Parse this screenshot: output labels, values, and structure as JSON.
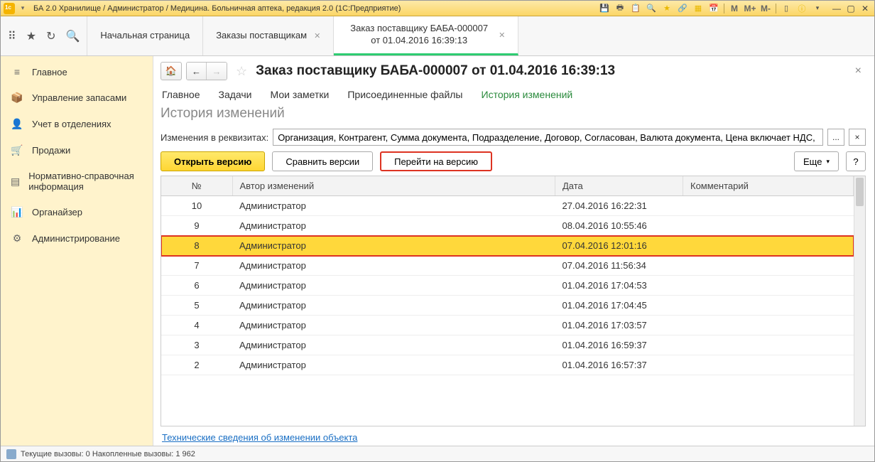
{
  "titlebar": {
    "text": "БА 2.0 Хранилище / Администратор / Медицина. Больничная аптека, редакция 2.0  (1С:Предприятие)",
    "m": "M",
    "mplus": "M+",
    "mminus": "M-"
  },
  "tabs": {
    "start": "Начальная страница",
    "orders": "Заказы поставщикам",
    "order": "Заказ поставщику БАБА-000007 от 01.04.2016 16:39:13"
  },
  "nav": {
    "main": "Главное",
    "inventory": "Управление запасами",
    "dept": "Учет в отделениях",
    "sales": "Продажи",
    "catalog": "Нормативно-справочная информация",
    "organizer": "Органайзер",
    "admin": "Администрирование"
  },
  "page": {
    "title": "Заказ поставщику БАБА-000007 от 01.04.2016 16:39:13",
    "subtabs": {
      "main": "Главное",
      "tasks": "Задачи",
      "notes": "Мои заметки",
      "files": "Присоединенные файлы",
      "history": "История изменений"
    },
    "section_title": "История изменений",
    "filter_label": "Изменения в реквизитах:",
    "filter_value": "Организация, Контрагент, Сумма документа, Подразделение, Договор, Согласован, Валюта документа, Цена включает НДС, Сп",
    "ellipsis": "...",
    "x": "×",
    "buttons": {
      "open": "Открыть версию",
      "compare": "Сравнить версии",
      "goto": "Перейти на версию",
      "more": "Еще",
      "help": "?"
    },
    "table": {
      "headers": {
        "num": "№",
        "author": "Автор изменений",
        "date": "Дата",
        "comment": "Комментарий"
      },
      "rows": [
        {
          "num": "10",
          "author": "Администратор",
          "date": "27.04.2016 16:22:31",
          "comment": ""
        },
        {
          "num": "9",
          "author": "Администратор",
          "date": "08.04.2016 10:55:46",
          "comment": ""
        },
        {
          "num": "8",
          "author": "Администратор",
          "date": "07.04.2016 12:01:16",
          "comment": "",
          "selected": true
        },
        {
          "num": "7",
          "author": "Администратор",
          "date": "07.04.2016 11:56:34",
          "comment": ""
        },
        {
          "num": "6",
          "author": "Администратор",
          "date": "01.04.2016 17:04:53",
          "comment": ""
        },
        {
          "num": "5",
          "author": "Администратор",
          "date": "01.04.2016 17:04:45",
          "comment": ""
        },
        {
          "num": "4",
          "author": "Администратор",
          "date": "01.04.2016 17:03:57",
          "comment": ""
        },
        {
          "num": "3",
          "author": "Администратор",
          "date": "01.04.2016 16:59:37",
          "comment": ""
        },
        {
          "num": "2",
          "author": "Администратор",
          "date": "01.04.2016 16:57:37",
          "comment": ""
        }
      ]
    },
    "tech_link": "Технические сведения об изменении объекта"
  },
  "status": {
    "text": "Текущие вызовы: 0   Накопленные вызовы: 1 962"
  }
}
